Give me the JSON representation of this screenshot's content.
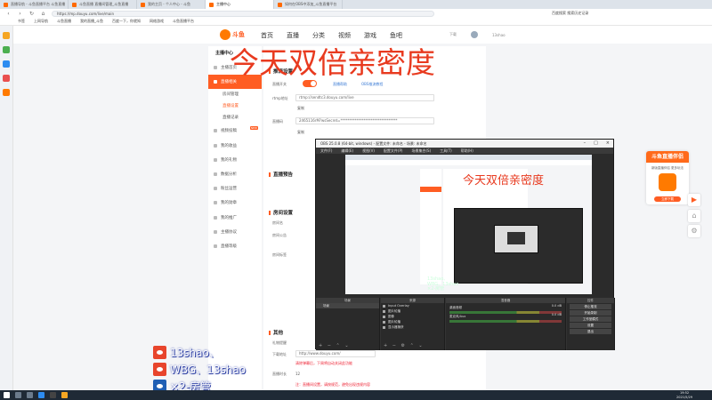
{
  "browser": {
    "tabs": [
      {
        "label": "直播导航 - 斗鱼直播平台 斗鱼直播"
      },
      {
        "label": "斗鱼直播 直播间管理_斗鱼直播"
      },
      {
        "label": "我的主页 - 个人中心 - 斗鱼"
      },
      {
        "label": "主播中心"
      },
      {
        "label": "如何在OBS中添加_斗鱼直播平台"
      }
    ],
    "url": "https://mp.douyu.com/live/main",
    "search_hint": "百度搜索 搜索历史记录",
    "bookmarks": [
      "书签",
      "上网导航",
      "斗鱼直播",
      "我的直播_斗鱼",
      "百度一下，你就知",
      "网络游戏",
      "斗鱼直播平台"
    ]
  },
  "site": {
    "logo_text": "斗鱼",
    "nav": [
      "首页",
      "直播",
      "分类",
      "视频",
      "游戏",
      "鱼吧"
    ],
    "header_right": [
      "下载",
      "13shao"
    ]
  },
  "sidebar": {
    "title": "主播中心",
    "items": [
      {
        "label": "主播首页",
        "active": false
      },
      {
        "label": "直播相关",
        "active": true
      },
      {
        "label": "房间管理",
        "sub": true,
        "active": false
      },
      {
        "label": "直播设置",
        "sub": true,
        "active": true
      },
      {
        "label": "直播记录",
        "sub": true,
        "active": false
      },
      {
        "label": "视频投稿",
        "active": false,
        "badge": "NEW"
      },
      {
        "label": "我的收益",
        "active": false
      },
      {
        "label": "我的礼物",
        "active": false
      },
      {
        "label": "数据分析",
        "active": false
      },
      {
        "label": "粉丝运营",
        "active": false
      },
      {
        "label": "我的勋章",
        "active": false
      },
      {
        "label": "我的推广",
        "active": false
      },
      {
        "label": "主播协议",
        "active": false
      },
      {
        "label": "直播等级",
        "active": false
      }
    ]
  },
  "content": {
    "section1": "推流设置",
    "live_switch_label": "直播开关",
    "rtmp_label": "rtmp地址",
    "rtmp_value": "rtmp://sendtc3.douyu.com/live",
    "copy": "复制",
    "stream_key_label": "直播码",
    "stream_key_value": "2465116rM?wsSecret=********************************",
    "links": [
      "直播帮助",
      "OBS推流教程"
    ],
    "section2": "直播预告",
    "section3": "房间设置",
    "section4": "其他",
    "room_label_a": "房间名",
    "room_label_b": "房间公告",
    "room_label_c": "房间标签",
    "other_label_a": "礼物提醒",
    "other_label_b": "下载地址",
    "other_url": "http://www.douyu.com/",
    "other_note": "清除弹幕后，下周将自动关闭此功能",
    "level_label": "直播时长",
    "level_value": "12",
    "red_note": "注：直播间设置，请按规范，避免出现违规内容"
  },
  "overlay_title": "今天双倍亲密度",
  "obs": {
    "title": "OBS 25.0.8 (64-bit, windows) - 配置文件: 未命名 - 场景: 未命名",
    "menu": [
      "文件(F)",
      "编辑(E)",
      "视图(V)",
      "配置文件(P)",
      "场景集合(S)",
      "工具(T)",
      "帮助(H)"
    ],
    "docks": {
      "scenes": "场景",
      "sources": "来源",
      "mixer": "混音器",
      "transitions": "转场特效",
      "controls": "控件"
    },
    "scene_item": "场景",
    "sources": [
      "Input Overlay",
      "图片轮播",
      "图像",
      "图片轮播",
      "显示器捕获"
    ],
    "mixer": [
      {
        "label": "桌面音频",
        "value": "0.0 dB"
      },
      {
        "label": "麦克风/Aux",
        "value": "0.0 dB"
      }
    ],
    "controls": [
      "停止推流",
      "开始录制",
      "工作室模式",
      "设置",
      "退出"
    ],
    "status": [
      "LIVE: 00:12:08",
      "REC: 00:00:00",
      "CPU: 4.2%"
    ]
  },
  "weibo_overlay": {
    "line1": "13shao、",
    "line2": "WBG、13shao",
    "line3": "×2-房管"
  },
  "promo": {
    "head": "斗鱼直播伴侣",
    "sub": "新版直播伴侣 更多玩法",
    "button": "立即下载"
  },
  "taskbar": {
    "time": "19:52",
    "date": "2021/5/29"
  },
  "colors": {
    "brand": "#ff5d23",
    "overlay_red": "#e83a1f",
    "obs_bg": "#2b2b2b"
  }
}
